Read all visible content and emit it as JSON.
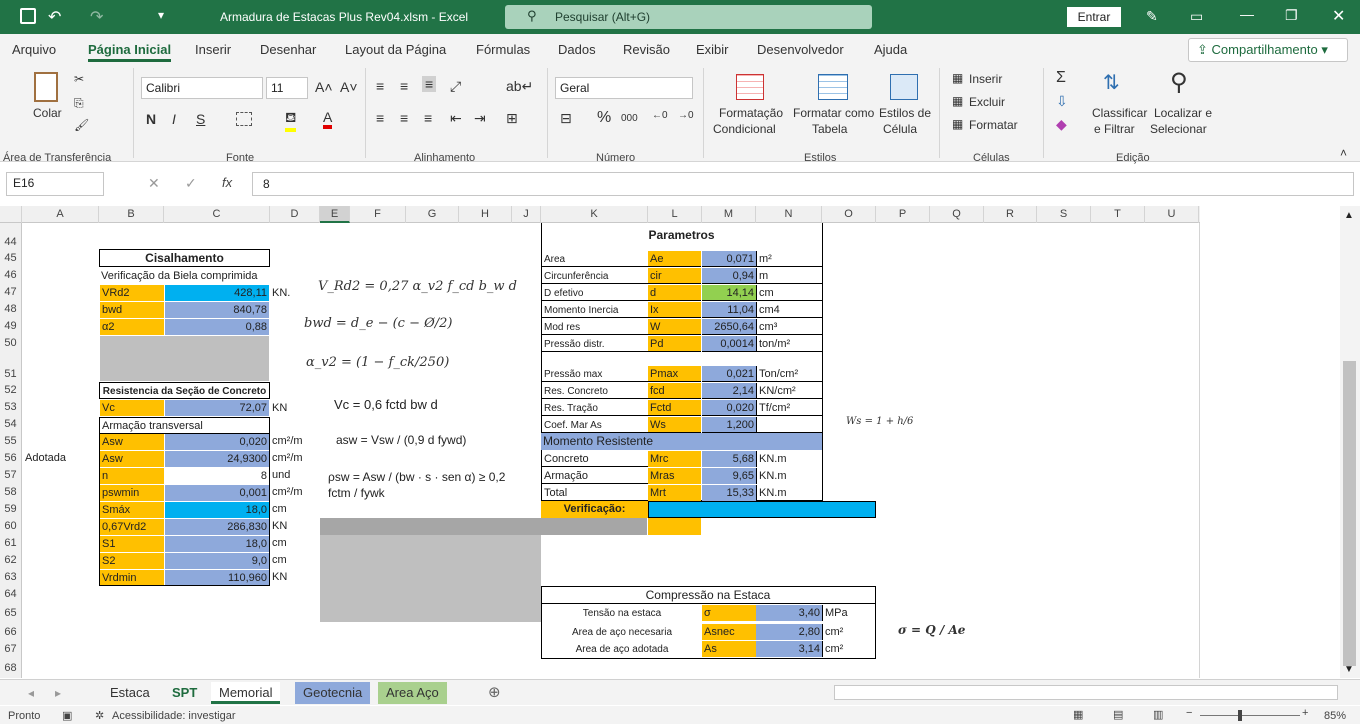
{
  "title": {
    "text": "Armadura de Estacas Plus Rev04.xlsm  -  Excel",
    "search": "Pesquisar (Alt+G)",
    "signin": "Entrar"
  },
  "menu": [
    "Arquivo",
    "Página Inicial",
    "Inserir",
    "Desenhar",
    "Layout da Página",
    "Fórmulas",
    "Dados",
    "Revisão",
    "Exibir",
    "Desenvolvedor",
    "Ajuda"
  ],
  "share": "Compartilhamento",
  "ribbon": {
    "colar": "Colar",
    "area": "Área de Transferência",
    "font_name": "Calibri",
    "font_size": "11",
    "fonte": "Fonte",
    "alinhamento": "Alinhamento",
    "number_format": "Geral",
    "numero": "Número",
    "fmt_cond1": "Formatação",
    "fmt_cond2": "Condicional",
    "fmt_tab1": "Formatar como",
    "fmt_tab2": "Tabela",
    "est1": "Estilos de",
    "est2": "Célula",
    "estilos": "Estilos",
    "inserir": "Inserir",
    "excluir": "Excluir",
    "formatar": "Formatar",
    "celulas": "Células",
    "classificar1": "Classificar",
    "classificar2": "e Filtrar",
    "localizar1": "Localizar e",
    "localizar2": "Selecionar",
    "edicao": "Edição"
  },
  "formula_bar": {
    "name_box": "E16",
    "value": "8"
  },
  "columns": [
    "A",
    "B",
    "C",
    "D",
    "E",
    "F",
    "G",
    "H",
    "J",
    "K",
    "L",
    "M",
    "N",
    "O",
    "P",
    "Q",
    "R",
    "S",
    "T",
    "U"
  ],
  "rows": [
    "44",
    "45",
    "46",
    "47",
    "48",
    "49",
    "50",
    "51",
    "52",
    "53",
    "54",
    "55",
    "56",
    "57",
    "58",
    "59",
    "60",
    "61",
    "62",
    "63",
    "64",
    "65",
    "66",
    "67",
    "68"
  ],
  "cisal": {
    "title": "Cisalhamento",
    "biela": "Verificação da Biela comprimida",
    "res_title": "Resistencia da Seção de Concreto",
    "armacao": "Armação transversal",
    "adotada": "Adotada",
    "items": [
      [
        "VRd2",
        "428,11",
        "KN."
      ],
      [
        "bwd",
        "840,78",
        ""
      ],
      [
        "α2",
        "0,88",
        ""
      ]
    ],
    "vc": [
      "Vc",
      "72,07",
      "KN"
    ],
    "items2": [
      [
        "Asw",
        "0,020",
        "cm²/m"
      ],
      [
        "Asw",
        "24,9300",
        "cm²/m"
      ],
      [
        "n",
        "8",
        "und"
      ],
      [
        "pswmin",
        "0,001",
        "cm²/m"
      ],
      [
        "Smáx",
        "18,0",
        "cm"
      ],
      [
        "0,67Vrd2",
        "286,830",
        "KN"
      ],
      [
        "S1",
        "18,0",
        "cm"
      ],
      [
        "S2",
        "9,0",
        "cm"
      ],
      [
        "Vrdmin",
        "110,960",
        "KN"
      ]
    ]
  },
  "params": {
    "title": "Parametros",
    "items": [
      [
        "Area",
        "Ae",
        "0,071",
        "m²"
      ],
      [
        "Circunferência",
        "cir",
        "0,94",
        "m"
      ],
      [
        "D efetivo",
        "d",
        "14,14",
        "cm"
      ],
      [
        "Momento Inercia",
        "Ix",
        "11,04",
        "cm4"
      ],
      [
        "Mod res",
        "W",
        "2650,64",
        "cm³"
      ],
      [
        "Pressão distr.",
        "Pd",
        "0,0014",
        "ton/m²"
      ],
      [
        "Pressão max",
        "Pmax",
        "0,021",
        "Ton/cm²"
      ],
      [
        "Res. Concreto",
        "fcd",
        "2,14",
        "KN/cm²"
      ],
      [
        "Res. Tração",
        "Fctd",
        "0,020",
        "Tf/cm²"
      ],
      [
        "Coef. Mar As",
        "Ws",
        "1,200",
        ""
      ]
    ],
    "momento": "Momento Resistente",
    "mom": [
      [
        "Concreto",
        "Mrc",
        "5,68",
        "KN.m"
      ],
      [
        "Armação",
        "Mras",
        "9,65",
        "KN.m"
      ],
      [
        "Total",
        "Mrt",
        "15,33",
        "KN.m"
      ]
    ],
    "verif": "Verificação:"
  },
  "comp": {
    "title": "Compressão na Estaca",
    "items": [
      [
        "Tensão na estaca",
        "σ",
        "3,40",
        "MPa"
      ],
      [
        "Area de aço necesaria",
        "Asnec",
        "2,80",
        "cm²"
      ],
      [
        "Area de aço adotada",
        "As",
        "3,14",
        "cm²"
      ]
    ]
  },
  "formulas": {
    "f1": "V_Rd2 = 0,27 α_v2 f_cd b_w d",
    "f2": "bwd = d_e − (c − Ø/2)",
    "f3": "α_v2 = (1 − f_ck/250)",
    "f4": "Vc = 0,6 fctd bw d",
    "f5": "asw = Vsw / (0,9 d fywd)",
    "f6": "ρsw = Asw / (bw · s · sen α) ≥ 0,2 fctm / fywk",
    "f7": "Ws = 1 + h/6",
    "f8": "σ = Q / Ae"
  },
  "sheets": [
    "Estaca",
    "SPT",
    "Memorial",
    "Geotecnia",
    "Area Aço"
  ],
  "status": {
    "ready": "Pronto",
    "access": "Acessibilidade: investigar",
    "zoom": "85%"
  }
}
